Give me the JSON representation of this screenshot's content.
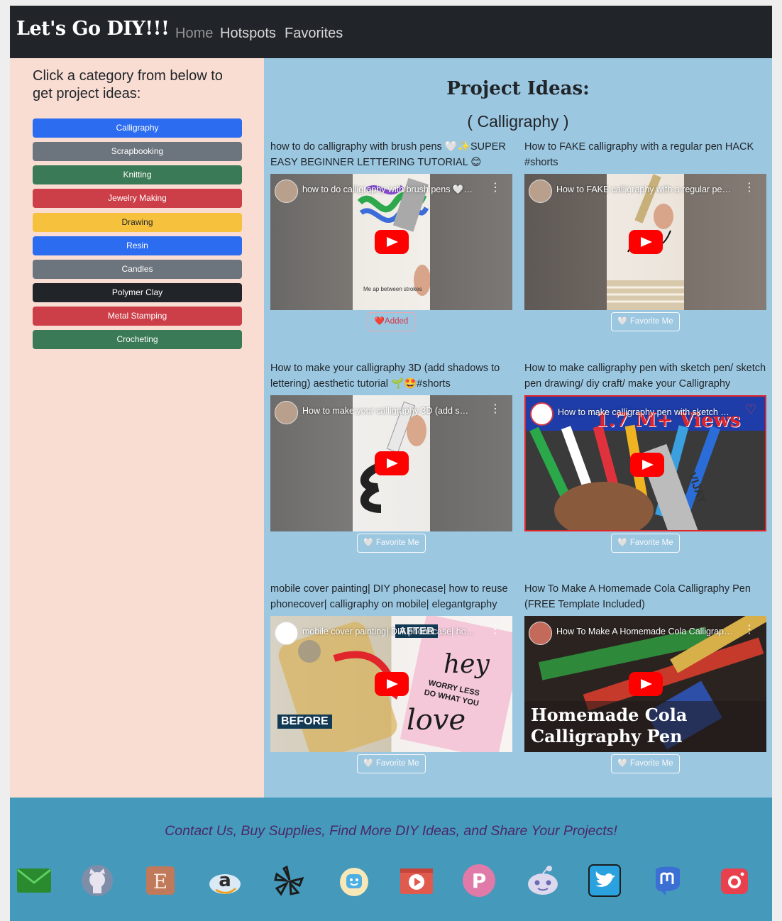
{
  "navbar": {
    "brand": "Let's Go DIY!!!",
    "links": [
      "Home",
      "Hotspots",
      "Favorites"
    ]
  },
  "sidebar": {
    "title": "Click a category from below to get project ideas:",
    "categories": [
      {
        "label": "Calligraphy",
        "color": "#2b6cf0"
      },
      {
        "label": "Scrapbooking",
        "color": "#6c757d"
      },
      {
        "label": "Knitting",
        "color": "#3a7a56"
      },
      {
        "label": "Jewelry Making",
        "color": "#cc3e48"
      },
      {
        "label": "Drawing",
        "color": "#f6c23e"
      },
      {
        "label": "Resin",
        "color": "#2b6cf0"
      },
      {
        "label": "Candles",
        "color": "#6c757d"
      },
      {
        "label": "Polymer Clay",
        "color": "#212529"
      },
      {
        "label": "Metal Stamping",
        "color": "#cc3e48"
      },
      {
        "label": "Crocheting",
        "color": "#3a7a56"
      }
    ]
  },
  "main": {
    "title": "Project Ideas:",
    "subtitle": "( Calligraphy )",
    "videos": [
      {
        "title": "how to do calligraphy with brush pens 🤍✨SUPER EASY BEGINNER LETTERING TUTORIAL 😊#shorts",
        "player_title": "how to do calligraphy with brush pens 🤍…",
        "button": "❤️Added",
        "added": true
      },
      {
        "title": "How to FAKE calligraphy with a regular pen HACK #shorts",
        "player_title": "How to FAKE calligraphy with a regular pe…",
        "button": "🤍 Favorite Me",
        "added": false
      },
      {
        "title": "How to make your calligraphy 3D (add shadows to lettering) aesthetic tutorial 🌱🤩#shorts",
        "player_title": "How to make your calligraphy 3D (add s…",
        "button": "🤍 Favorite Me",
        "added": false
      },
      {
        "title": "How to make calligraphy pen with sketch pen/ sketch pen drawing/ diy craft/ make your Calligraphy",
        "player_title": "How to make calligraphy pen with sketch …",
        "button": "🤍 Favorite Me",
        "added": false
      },
      {
        "title": "mobile cover painting| DIY phonecase| how to reuse phonecover| calligraphy on mobile| elegantgraphy",
        "player_title": "mobile cover painting| DIY phonecase| ho…",
        "button": "🤍 Favorite Me",
        "added": false
      },
      {
        "title": "How To Make A Homemade Cola Calligraphy Pen (FREE Template Included)",
        "player_title": "How To Make A Homemade Cola Calligrap…",
        "button": "🤍 Favorite Me",
        "added": false
      }
    ],
    "thumb_text": {
      "v1": "Me ap between strokes",
      "v4": "1.7 M+ Views",
      "v4b": "VIJAY",
      "v5a": "AFTER",
      "v5b": "BEFORE",
      "v5c": "hey",
      "v5d": "WORRY LESS",
      "v5e": "DO WHAT YOU",
      "v5f": "love",
      "v6a": "Homemade Cola",
      "v6b": "Calligraphy Pen"
    }
  },
  "footer": {
    "text": "Contact Us, Buy Supplies, Find More DIY Ideas, and Share Your Projects!",
    "icons": [
      "email-icon",
      "github-icon",
      "etsy-icon",
      "amazon-icon",
      "yelp-icon",
      "waze-icon",
      "youtube-icon",
      "pinterest-icon",
      "reddit-icon",
      "twitter-icon",
      "mastodon-icon",
      "instagram-icon"
    ]
  },
  "colors": {
    "navbar": "#212529",
    "sidebar": "#f9ddd3",
    "main": "#9bc7e1",
    "footer": "#4599ba",
    "footer_text": "#4b2769"
  }
}
